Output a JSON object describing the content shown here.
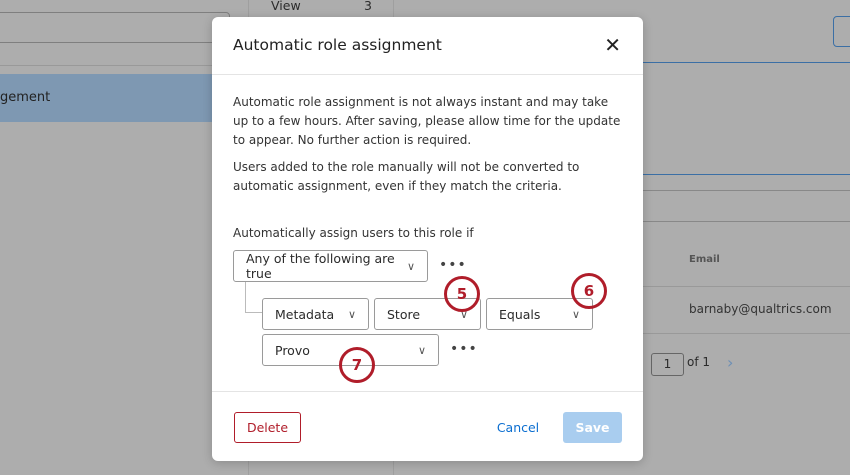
{
  "background": {
    "view_label": "View",
    "view_count": "3",
    "selected_item": "gement",
    "email_header": "Email",
    "email_value": "barnaby@qualtrics.com",
    "page_input": "1",
    "page_of": "of 1"
  },
  "dialog": {
    "title": "Automatic role assignment",
    "para1": "Automatic role assignment is not always instant and may take up to a few hours. After saving, please allow time for the update to appear. No further action is required.",
    "para2": "Users added to the role manually will not be converted to automatic assignment, even if they match the criteria.",
    "condition_label": "Automatically assign users to this role if",
    "group_select": "Any of the following are true",
    "field_type": "Metadata",
    "field_name": "Store",
    "operator": "Equals",
    "value": "Provo",
    "delete_label": "Delete",
    "cancel_label": "Cancel",
    "save_label": "Save"
  },
  "callouts": [
    "5",
    "6",
    "7"
  ],
  "colors": {
    "accent": "#0b6ed0",
    "danger": "#b01d2a",
    "save_disabled": "#a9cdef"
  }
}
